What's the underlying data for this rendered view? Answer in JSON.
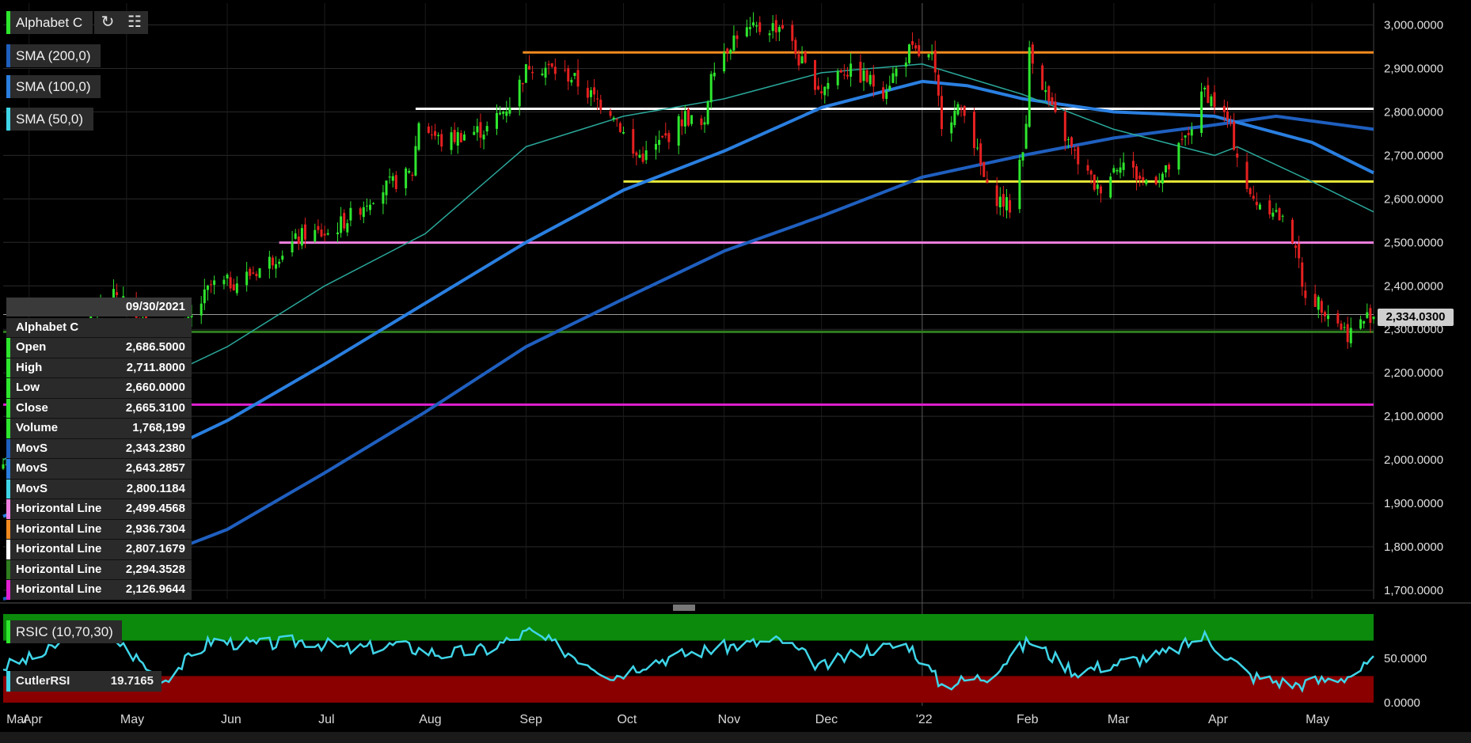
{
  "colors": {
    "bg": "#000000",
    "grid": "#2a2a2a",
    "up": "#2ee62e",
    "down": "#e62020",
    "sma200": "#1f5fbf",
    "sma100": "#2a7fe0",
    "sma50": "#2aa89a",
    "rsi_line": "#3fd5e8",
    "rsi_upper_zone": "#0b8a0b",
    "rsi_lower_zone": "#8a0000"
  },
  "tags": {
    "symbol": "Alphabet C",
    "sma200": "SMA (200,0)",
    "sma100": "SMA (100,0)",
    "sma50": "SMA (50,0)",
    "rsi": "RSIC (10,70,30)",
    "refresh_icon": "refresh-icon",
    "settings_icon": "chart-settings-icon"
  },
  "rsi_panel": {
    "label": "CutlerRSI",
    "value": "19.7165"
  },
  "last_price": "2,334.0300",
  "data_window": {
    "date": "09/30/2021",
    "name": "Alphabet C",
    "rows": [
      {
        "label": "Open",
        "value": "2,686.5000",
        "color": "#2ee62e"
      },
      {
        "label": "High",
        "value": "2,711.8000",
        "color": "#2ee62e"
      },
      {
        "label": "Low",
        "value": "2,660.0000",
        "color": "#2ee62e"
      },
      {
        "label": "Close",
        "value": "2,665.3100",
        "color": "#2ee62e"
      },
      {
        "label": "Volume",
        "value": "1,768,199",
        "color": "#2ee62e"
      },
      {
        "label": "MovS",
        "value": "2,343.2380",
        "color": "#1f5fbf"
      },
      {
        "label": "MovS",
        "value": "2,643.2857",
        "color": "#2a7fe0"
      },
      {
        "label": "MovS",
        "value": "2,800.1184",
        "color": "#3fd5e8"
      },
      {
        "label": "Horizontal Line",
        "value": "2,499.4568",
        "color": "#f080e0"
      },
      {
        "label": "Horizontal Line",
        "value": "2,936.7304",
        "color": "#f08a20"
      },
      {
        "label": "Horizontal Line",
        "value": "2,807.1679",
        "color": "#ffffff"
      },
      {
        "label": "Horizontal Line",
        "value": "2,294.3528",
        "color": "#2f7d1f"
      },
      {
        "label": "Horizontal Line",
        "value": "2,126.9644",
        "color": "#e020d0"
      }
    ]
  },
  "chart_data": {
    "type": "candlestick",
    "ylim": [
      1680,
      3050
    ],
    "y_ticks": [
      "3,000.0000",
      "2,900.0000",
      "2,800.0000",
      "2,700.0000",
      "2,600.0000",
      "2,500.0000",
      "2,400.0000",
      "2,300.0000",
      "2,200.0000",
      "2,100.0000",
      "2,000.0000",
      "1,900.0000",
      "1,800.0000",
      "1,700.0000"
    ],
    "y_tick_values": [
      3000,
      2900,
      2800,
      2700,
      2600,
      2500,
      2400,
      2300,
      2200,
      2100,
      2000,
      1900,
      1800,
      1700
    ],
    "x_labels": [
      "Mar",
      "Apr",
      "May",
      "Jun",
      "Jul",
      "Aug",
      "Sep",
      "Oct",
      "Nov",
      "Dec",
      "'22",
      "Feb",
      "Mar",
      "Apr",
      "May"
    ],
    "x_label_dates": [
      "2021-03-25",
      "2021-04-01",
      "2021-05-01",
      "2021-06-01",
      "2021-07-01",
      "2021-08-01",
      "2021-09-01",
      "2021-10-01",
      "2021-11-01",
      "2021-12-01",
      "2022-01-01",
      "2022-02-01",
      "2022-03-01",
      "2022-04-01",
      "2022-05-01"
    ],
    "x_range": [
      "2021-03-24",
      "2022-05-20"
    ],
    "price_anchors": [
      [
        "2021-03-24",
        1990
      ],
      [
        "2021-04-06",
        2120
      ],
      [
        "2021-04-16",
        2300
      ],
      [
        "2021-04-28",
        2380
      ],
      [
        "2021-05-05",
        2340
      ],
      [
        "2021-05-12",
        2250
      ],
      [
        "2021-05-19",
        2300
      ],
      [
        "2021-05-27",
        2400
      ],
      [
        "2021-06-04",
        2410
      ],
      [
        "2021-06-11",
        2440
      ],
      [
        "2021-06-18",
        2480
      ],
      [
        "2021-06-25",
        2520
      ],
      [
        "2021-07-02",
        2520
      ],
      [
        "2021-07-09",
        2560
      ],
      [
        "2021-07-16",
        2610
      ],
      [
        "2021-07-23",
        2640
      ],
      [
        "2021-07-28",
        2660
      ],
      [
        "2021-07-30",
        2780
      ],
      [
        "2021-08-06",
        2730
      ],
      [
        "2021-08-13",
        2750
      ],
      [
        "2021-08-20",
        2760
      ],
      [
        "2021-08-27",
        2820
      ],
      [
        "2021-09-02",
        2910
      ],
      [
        "2021-09-08",
        2900
      ],
      [
        "2021-09-15",
        2880
      ],
      [
        "2021-09-22",
        2830
      ],
      [
        "2021-09-28",
        2800
      ],
      [
        "2021-10-04",
        2700
      ],
      [
        "2021-10-08",
        2700
      ],
      [
        "2021-10-14",
        2740
      ],
      [
        "2021-10-20",
        2790
      ],
      [
        "2021-10-26",
        2760
      ],
      [
        "2021-10-28",
        2900
      ],
      [
        "2021-11-05",
        2980
      ],
      [
        "2021-11-12",
        2990
      ],
      [
        "2021-11-19",
        3000
      ],
      [
        "2021-11-24",
        2920
      ],
      [
        "2021-12-01",
        2850
      ],
      [
        "2021-12-07",
        2900
      ],
      [
        "2021-12-14",
        2880
      ],
      [
        "2021-12-20",
        2850
      ],
      [
        "2021-12-28",
        2940
      ],
      [
        "2022-01-04",
        2920
      ],
      [
        "2022-01-07",
        2780
      ],
      [
        "2022-01-14",
        2810
      ],
      [
        "2022-01-21",
        2620
      ],
      [
        "2022-01-28",
        2580
      ],
      [
        "2022-02-02",
        2760
      ],
      [
        "2022-02-03",
        2950
      ],
      [
        "2022-02-10",
        2800
      ],
      [
        "2022-02-17",
        2700
      ],
      [
        "2022-02-24",
        2620
      ],
      [
        "2022-03-03",
        2690
      ],
      [
        "2022-03-10",
        2640
      ],
      [
        "2022-03-17",
        2660
      ],
      [
        "2022-03-24",
        2750
      ],
      [
        "2022-03-29",
        2850
      ],
      [
        "2022-04-05",
        2780
      ],
      [
        "2022-04-12",
        2600
      ],
      [
        "2022-04-19",
        2580
      ],
      [
        "2022-04-26",
        2500
      ],
      [
        "2022-04-28",
        2390
      ],
      [
        "2022-05-05",
        2350
      ],
      [
        "2022-05-12",
        2290
      ],
      [
        "2022-05-19",
        2334
      ]
    ],
    "horizontal_lines": [
      {
        "value": 2936.7304,
        "color": "#f08a20",
        "from": "2021-08-31"
      },
      {
        "value": 2807.1679,
        "color": "#ffffff",
        "from": "2021-07-29"
      },
      {
        "value": 2640,
        "color": "#e8e838",
        "from": "2021-10-01"
      },
      {
        "value": 2499.4568,
        "color": "#f080e0",
        "from": "2021-06-17"
      },
      {
        "value": 2294.3528,
        "color": "#2f7d1f",
        "from": "2021-03-24"
      },
      {
        "value": 2126.9644,
        "color": "#e020d0",
        "from": "2021-03-24"
      }
    ],
    "sma50": [
      [
        "2021-03-24",
        2000
      ],
      [
        "2021-05-01",
        2150
      ],
      [
        "2021-06-01",
        2260
      ],
      [
        "2021-07-01",
        2400
      ],
      [
        "2021-08-01",
        2520
      ],
      [
        "2021-09-01",
        2720
      ],
      [
        "2021-10-01",
        2790
      ],
      [
        "2021-11-01",
        2830
      ],
      [
        "2021-12-01",
        2890
      ],
      [
        "2022-01-01",
        2910
      ],
      [
        "2022-02-01",
        2840
      ],
      [
        "2022-03-01",
        2760
      ],
      [
        "2022-04-01",
        2700
      ],
      [
        "2022-04-08",
        2720
      ],
      [
        "2022-05-01",
        2640
      ],
      [
        "2022-05-20",
        2570
      ]
    ],
    "sma100": [
      [
        "2021-03-24",
        1870
      ],
      [
        "2021-05-01",
        1980
      ],
      [
        "2021-06-01",
        2090
      ],
      [
        "2021-07-01",
        2220
      ],
      [
        "2021-08-01",
        2360
      ],
      [
        "2021-09-01",
        2500
      ],
      [
        "2021-10-01",
        2620
      ],
      [
        "2021-11-01",
        2710
      ],
      [
        "2021-12-01",
        2810
      ],
      [
        "2022-01-01",
        2870
      ],
      [
        "2022-01-15",
        2860
      ],
      [
        "2022-02-01",
        2830
      ],
      [
        "2022-03-01",
        2800
      ],
      [
        "2022-04-01",
        2790
      ],
      [
        "2022-05-01",
        2730
      ],
      [
        "2022-05-20",
        2660
      ]
    ],
    "sma200": [
      [
        "2021-03-24",
        1680
      ],
      [
        "2021-05-01",
        1750
      ],
      [
        "2021-06-01",
        1840
      ],
      [
        "2021-07-01",
        1970
      ],
      [
        "2021-08-01",
        2110
      ],
      [
        "2021-09-01",
        2260
      ],
      [
        "2021-10-01",
        2370
      ],
      [
        "2021-11-01",
        2480
      ],
      [
        "2021-12-01",
        2560
      ],
      [
        "2022-01-01",
        2650
      ],
      [
        "2022-02-01",
        2700
      ],
      [
        "2022-03-01",
        2740
      ],
      [
        "2022-04-01",
        2770
      ],
      [
        "2022-04-20",
        2790
      ],
      [
        "2022-05-20",
        2760
      ]
    ],
    "rsi_ylim": [
      0,
      100
    ],
    "rsi_ticks": [
      "50.0000",
      "0.0000"
    ],
    "rsi_tick_values": [
      50,
      0
    ],
    "rsi_bands": [
      30,
      70
    ],
    "rsi_anchors": [
      [
        "2021-03-24",
        40
      ],
      [
        "2021-04-06",
        55
      ],
      [
        "2021-04-16",
        85
      ],
      [
        "2021-04-28",
        70
      ],
      [
        "2021-05-12",
        25
      ],
      [
        "2021-05-27",
        70
      ],
      [
        "2021-06-11",
        65
      ],
      [
        "2021-06-25",
        70
      ],
      [
        "2021-07-09",
        60
      ],
      [
        "2021-07-23",
        65
      ],
      [
        "2021-08-06",
        55
      ],
      [
        "2021-08-20",
        60
      ],
      [
        "2021-09-02",
        80
      ],
      [
        "2021-09-15",
        55
      ],
      [
        "2021-09-28",
        30
      ],
      [
        "2021-10-08",
        45
      ],
      [
        "2021-10-20",
        55
      ],
      [
        "2021-11-05",
        65
      ],
      [
        "2021-11-19",
        70
      ],
      [
        "2021-12-01",
        40
      ],
      [
        "2021-12-14",
        60
      ],
      [
        "2021-12-28",
        65
      ],
      [
        "2022-01-07",
        20
      ],
      [
        "2022-01-21",
        30
      ],
      [
        "2022-02-03",
        70
      ],
      [
        "2022-02-17",
        35
      ],
      [
        "2022-03-03",
        45
      ],
      [
        "2022-03-17",
        55
      ],
      [
        "2022-03-29",
        75
      ],
      [
        "2022-04-12",
        30
      ],
      [
        "2022-04-26",
        20
      ],
      [
        "2022-05-12",
        30
      ],
      [
        "2022-05-20",
        45
      ]
    ]
  }
}
